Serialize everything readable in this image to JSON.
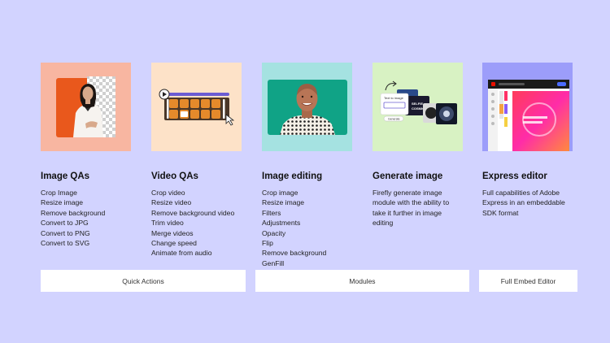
{
  "columns": [
    {
      "title": "Image QAs",
      "items": [
        "Crop Image",
        "Resize image",
        "Remove background",
        "Convert to JPG",
        "Convert to PNG",
        "Convert to SVG"
      ]
    },
    {
      "title": "Video QAs",
      "items": [
        "Crop video",
        "Resize video",
        "Remove background video",
        "Trim video",
        "Merge videos",
        "Change speed",
        "Animate from audio"
      ]
    },
    {
      "title": "Image editing",
      "items": [
        "Crop image",
        "Resize image",
        "Filters",
        "Adjustments",
        "Opacity",
        "Flip",
        "Remove background",
        "GenFill"
      ]
    },
    {
      "title": "Generate image",
      "description": "Firefly generate image module with the ability to take it further in image editing"
    },
    {
      "title": "Express editor",
      "description": "Full capabilities of Adobe Express in an embeddable SDK format"
    }
  ],
  "buttons": {
    "quick_actions": "Quick Actions",
    "modules": "Modules",
    "full_embed_editor": "Full Embed Editor"
  },
  "card_text": {
    "text_to_image": "Text to image",
    "selfie_badge": "SELFIE",
    "cosmic_badge": "COSMIC",
    "generate": "Generate"
  },
  "colors": {
    "background": "#d2d3ff",
    "card_image_qas": "#f8b6a1",
    "card_video_qas": "#fde2c8",
    "card_image_editing": "#a5e2e1",
    "card_generate_image": "#d8f2c3",
    "card_express_editor": "#9c9dfa",
    "button_bg": "#ffffff"
  }
}
